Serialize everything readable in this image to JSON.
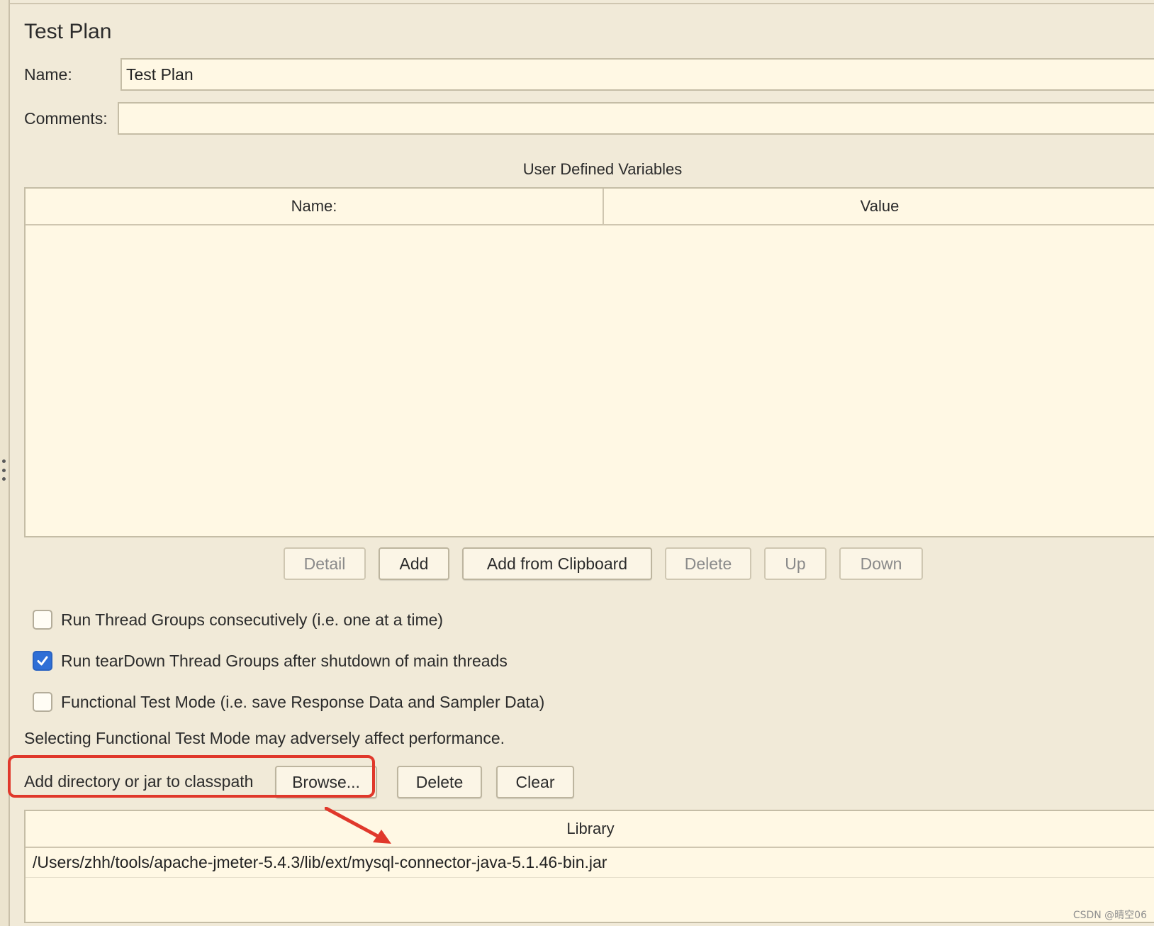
{
  "title": "Test Plan",
  "name_field": {
    "label": "Name:",
    "value": "Test Plan"
  },
  "comments_field": {
    "label": "Comments:",
    "value": ""
  },
  "user_defined_variables": {
    "title": "User Defined Variables",
    "columns": [
      "Name:",
      "Value"
    ],
    "rows": []
  },
  "variable_buttons": {
    "detail": "Detail",
    "add": "Add",
    "add_from_clipboard": "Add from Clipboard",
    "delete": "Delete",
    "up": "Up",
    "down": "Down"
  },
  "options": [
    {
      "label": "Run Thread Groups consecutively (i.e. one at a time)",
      "checked": false
    },
    {
      "label": "Run tearDown Thread Groups after shutdown of main threads",
      "checked": true
    },
    {
      "label": "Functional Test Mode (i.e. save Response Data and Sampler Data)",
      "checked": false
    }
  ],
  "functional_mode_note": "Selecting Functional Test Mode may adversely affect performance.",
  "classpath": {
    "label": "Add directory or jar to classpath",
    "browse": "Browse...",
    "delete": "Delete",
    "clear": "Clear"
  },
  "library_table": {
    "header": "Library",
    "rows": [
      "/Users/zhh/tools/apache-jmeter-5.4.3/lib/ext/mysql-connector-java-5.1.46-bin.jar"
    ]
  },
  "watermark": "CSDN @晴空06",
  "colors": {
    "background": "#f1ead8",
    "field_background": "#fff8e4",
    "checkbox_checked": "#2f6fd6",
    "highlight": "#e0382b"
  }
}
